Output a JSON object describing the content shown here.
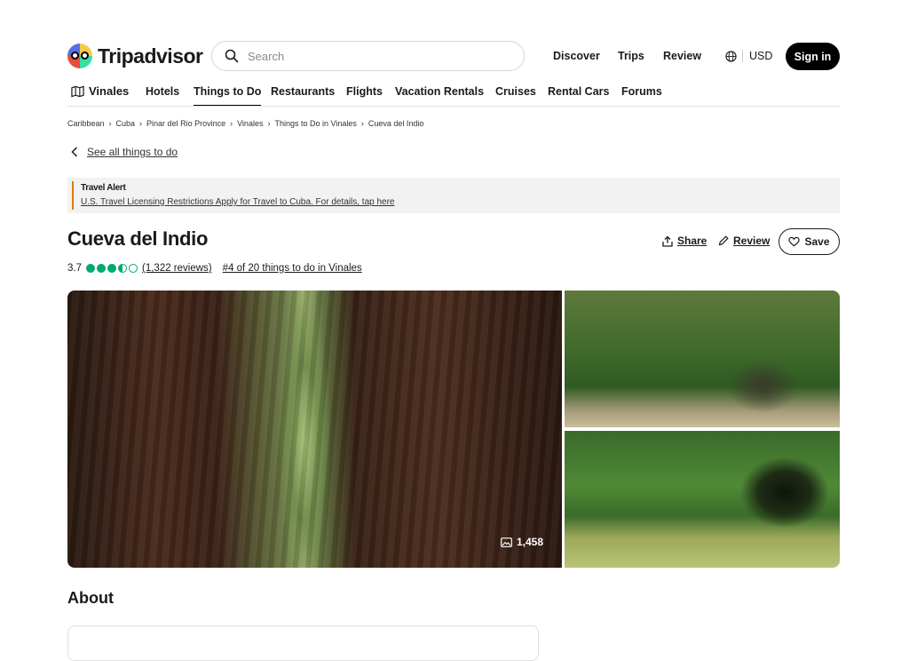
{
  "header": {
    "brand": "Tripadvisor",
    "search_placeholder": "Search",
    "nav": [
      "Discover",
      "Trips",
      "Review"
    ],
    "currency": "USD",
    "sign_in": "Sign in"
  },
  "subnav": {
    "location": "Vinales",
    "items": [
      "Hotels",
      "Things to Do",
      "Restaurants",
      "Flights",
      "Vacation Rentals",
      "Cruises",
      "Rental Cars",
      "Forums"
    ],
    "active": "Things to Do"
  },
  "breadcrumb": [
    "Caribbean",
    "Cuba",
    "Pinar del Rio Province",
    "Vinales",
    "Things to Do in Vinales",
    "Cueva del Indio"
  ],
  "back_link": "See all things to do",
  "alert": {
    "title": "Travel Alert",
    "message": "U.S. Travel Licensing Restrictions Apply for Travel to Cuba. For details, tap here",
    "accent": "#e07b00"
  },
  "attraction": {
    "name": "Cueva del Indio",
    "rating": "3.7",
    "rating_value": 3.5,
    "reviews": "(1,322 reviews)",
    "rank": "#4 of 20 things to do in Vinales",
    "share": "Share",
    "review": "Review",
    "save": "Save",
    "photo_count": "1,458"
  },
  "about": {
    "heading": "About"
  },
  "colors": {
    "brand_green": "#00aa6c",
    "button_dark": "#000000"
  }
}
